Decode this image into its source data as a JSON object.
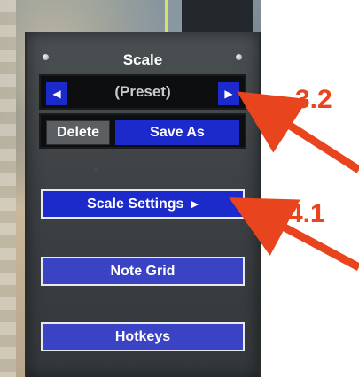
{
  "panel": {
    "title": "Scale",
    "preset": {
      "label": "(Preset)",
      "prev_icon": "triangle-left-icon",
      "next_icon": "triangle-right-icon"
    },
    "delete_label": "Delete",
    "save_as_label": "Save As",
    "scale_settings_label": "Scale Settings",
    "scale_settings_icon": "triangle-right-icon",
    "note_grid_label": "Note Grid",
    "hotkeys_label": "Hotkeys"
  },
  "annotations": [
    {
      "label": "3.2"
    },
    {
      "label": "4.1"
    }
  ],
  "colors": {
    "button_blue": "#1d2acb",
    "button_blue_light": "#3a43c4",
    "annotation_orange": "#e8451e",
    "panel_gray": "#3c4043"
  }
}
